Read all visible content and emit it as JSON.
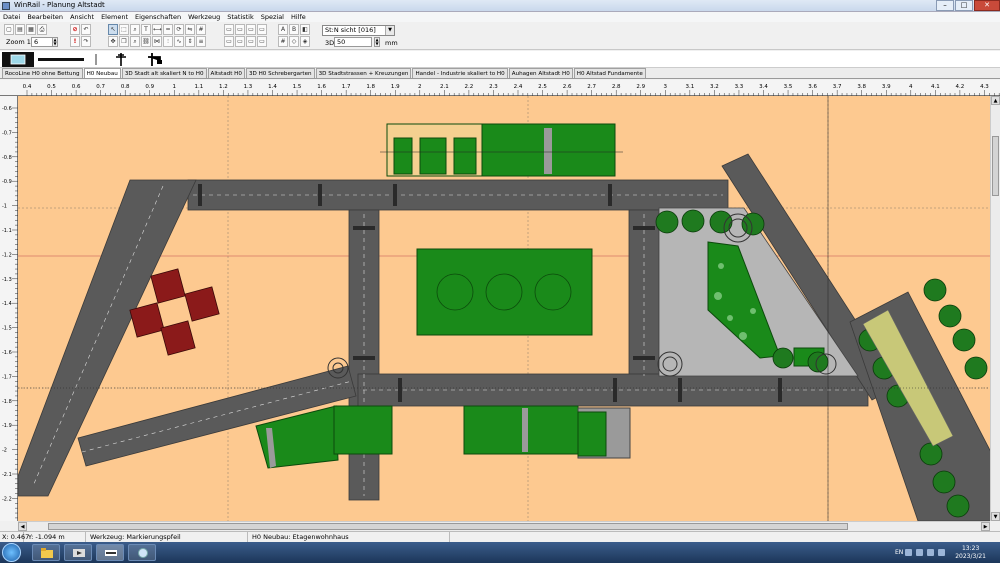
{
  "window": {
    "title": "WinRail - Planung Altstadt",
    "controls": {
      "minimize": "–",
      "maximize": "□",
      "close": "✕"
    }
  },
  "menu": [
    "Datei",
    "Bearbeiten",
    "Ansicht",
    "Element",
    "Eigenschaften",
    "Werkzeug",
    "Statistik",
    "Spezial",
    "Hilfe"
  ],
  "toolbar": {
    "zoom_label": "Zoom 1:",
    "zoom_value": "6",
    "view_select": "St:N sicht [016]",
    "field_3d_label": "3D:",
    "field_3d_value": "50",
    "field_3d_unit": "mm"
  },
  "tabs": [
    "RocoLine H0 ohne Bettung",
    "H0 Neubau",
    "3D Stadt alt skaliert N to H0",
    "Altstadt H0",
    "3D H0 Schrebergarten",
    "3D Stadtstrassen + Kreuzungen",
    "Handel - Industrie skaliert to H0",
    "Auhagen Altstadt H0",
    "H0 Altstad Fundamente"
  ],
  "active_tab": "H0 Neubau",
  "ruler_top": [
    "0.4",
    "0.5",
    "0.6",
    "0.7",
    "0.8",
    "0.9",
    "1",
    "1.1",
    "1.2",
    "1.3",
    "1.4",
    "1.5",
    "1.6",
    "1.7",
    "1.8",
    "1.9",
    "2",
    "2.1",
    "2.2",
    "2.3",
    "2.4",
    "2.5",
    "2.6",
    "2.7",
    "2.8",
    "2.9",
    "3",
    "3.1",
    "3.2",
    "3.3",
    "3.4",
    "3.5",
    "3.6",
    "3.7",
    "3.8",
    "3.9",
    "4",
    "4.1",
    "4.2",
    "4.3"
  ],
  "ruler_left": [
    "-0.6",
    "-0.7",
    "-0.8",
    "-0.9",
    "-1",
    "-1.1",
    "-1.2",
    "-1.3",
    "-1.4",
    "-1.5",
    "-1.6",
    "-1.7",
    "-1.8",
    "-1.9",
    "-2",
    "-2.1",
    "-2.2",
    "-2.3"
  ],
  "status": {
    "x": "X: 0.467",
    "y": "Y: -1.094 m",
    "tool": "Werkzeug: Markierungspfeil",
    "object": "H0 Neubau: Etagenwohnhaus"
  },
  "taskbar": {
    "language": "EN",
    "time": "13:23",
    "date": "2023/3/21"
  },
  "colors": {
    "canvas_bg": "#fdc990",
    "road": "#5a5a5a",
    "building_green": "#1a8a1a",
    "plaza_grey": "#b6b6b6",
    "tree_green": "#1f7a1f",
    "roof_red": "#8b1a1a"
  },
  "icons": [
    "new-icon",
    "open-icon",
    "save-icon",
    "print-icon",
    "stop-icon",
    "pointer-icon",
    "zoom-icon",
    "text-icon",
    "rotate-icon",
    "mirror-icon",
    "grid-icon"
  ]
}
